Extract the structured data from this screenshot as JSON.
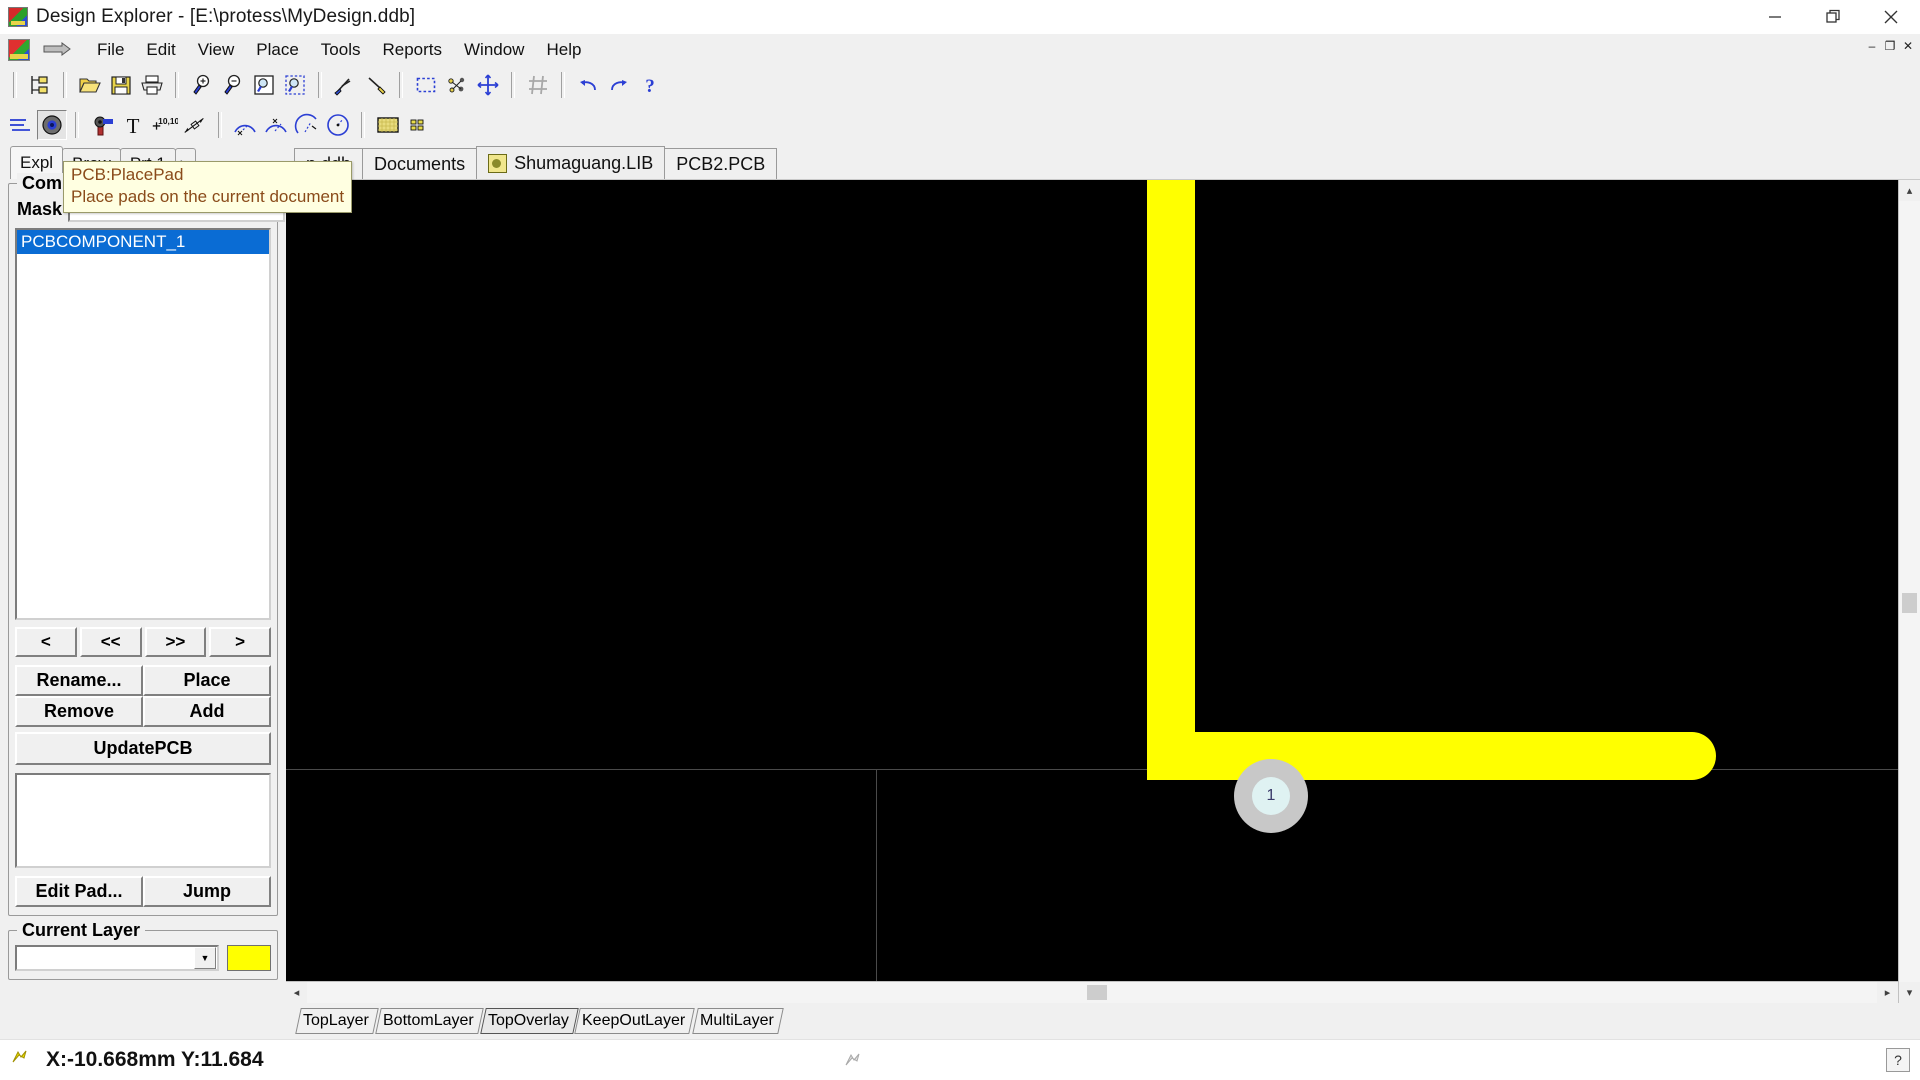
{
  "window": {
    "title": "Design Explorer - [E:\\protess\\MyDesign.ddb]",
    "minimize": "—",
    "maximize": "❐",
    "close": "✕"
  },
  "mdi": {
    "minimize": "–",
    "restore": "❐",
    "close": "✕"
  },
  "menu": {
    "items": [
      {
        "label": "File"
      },
      {
        "label": "Edit"
      },
      {
        "label": "View"
      },
      {
        "label": "Place"
      },
      {
        "label": "Tools"
      },
      {
        "label": "Reports"
      },
      {
        "label": "Window"
      },
      {
        "label": "Help"
      }
    ]
  },
  "toolbar_main": {
    "icons": [
      "design-explorer-icon",
      "open-folder-icon",
      "save-icon",
      "print-icon",
      "zoom-in-icon",
      "zoom-out-icon",
      "zoom-document-icon",
      "zoom-area-icon",
      "cut-icon",
      "paste-special-icon",
      "select-area-icon",
      "move-selection-icon",
      "move-icon",
      "toggle-grid-icon",
      "undo-icon",
      "redo-icon",
      "help-icon"
    ]
  },
  "toolbar_place": {
    "icons": [
      "place-track-icon",
      "place-pad-icon",
      "place-via-icon",
      "place-string-icon",
      "place-coordinate-icon",
      "place-dimension-icon",
      "place-arc-center-icon",
      "place-arc-edge-icon",
      "place-arc-any-icon",
      "place-full-circle-icon",
      "place-fill-icon",
      "place-array-icon"
    ],
    "active": "place-pad-icon"
  },
  "tooltip": {
    "title": "PCB:PlacePad",
    "description": "Place pads on the current document"
  },
  "panel": {
    "tabs": [
      {
        "label": "Expl",
        "active": true
      },
      {
        "label": "Brow",
        "active": false
      },
      {
        "label": "Prt 1",
        "active": false
      },
      {
        "label": "▶",
        "active": false
      }
    ],
    "components_group": {
      "legend": "Components",
      "mask_label": "Mask",
      "mask_value": "*",
      "mask_placeholder": "*",
      "items": [
        {
          "label": "PCBCOMPONENT_1",
          "selected": true
        }
      ],
      "nav": [
        {
          "label": "<",
          "name": "prev-component-button"
        },
        {
          "label": "<<",
          "name": "first-component-button"
        },
        {
          "label": ">>",
          "name": "last-component-button"
        },
        {
          "label": ">",
          "name": "next-component-button"
        }
      ],
      "actions": [
        {
          "label": "Rename...",
          "name": "rename-button"
        },
        {
          "label": "Place",
          "name": "place-button"
        },
        {
          "label": "Remove",
          "name": "remove-button"
        },
        {
          "label": "Add",
          "name": "add-button"
        }
      ],
      "update": "UpdatePCB",
      "pad_actions": [
        {
          "label": "Edit Pad...",
          "name": "edit-pad-button"
        },
        {
          "label": "Jump",
          "name": "jump-button"
        }
      ]
    },
    "current_layer": {
      "legend": "Current Layer",
      "value": "",
      "color": "#ffff00"
    }
  },
  "doctabs": [
    {
      "label": "n.ddb",
      "icon": "",
      "active": false
    },
    {
      "label": "Documents",
      "icon": "",
      "active": false
    },
    {
      "label": "Shumaguang.LIB",
      "icon": "library-icon",
      "active": true
    },
    {
      "label": "PCB2.PCB",
      "icon": "",
      "active": false
    }
  ],
  "canvas": {
    "background": "#000000",
    "track_color": "#ffff00",
    "pad": {
      "label": "1",
      "outer_color": "#c8c8c8",
      "hole_color": "#dff2f2"
    }
  },
  "layer_tabs": [
    {
      "label": "TopLayer",
      "active": false
    },
    {
      "label": "BottomLayer",
      "active": false
    },
    {
      "label": "TopOverlay",
      "active": true
    },
    {
      "label": "KeepOutLayer",
      "active": false
    },
    {
      "label": "MultiLayer",
      "active": false
    }
  ],
  "statusbar": {
    "coordinates": "X:-10.668mm Y:11.684",
    "help": "?"
  }
}
